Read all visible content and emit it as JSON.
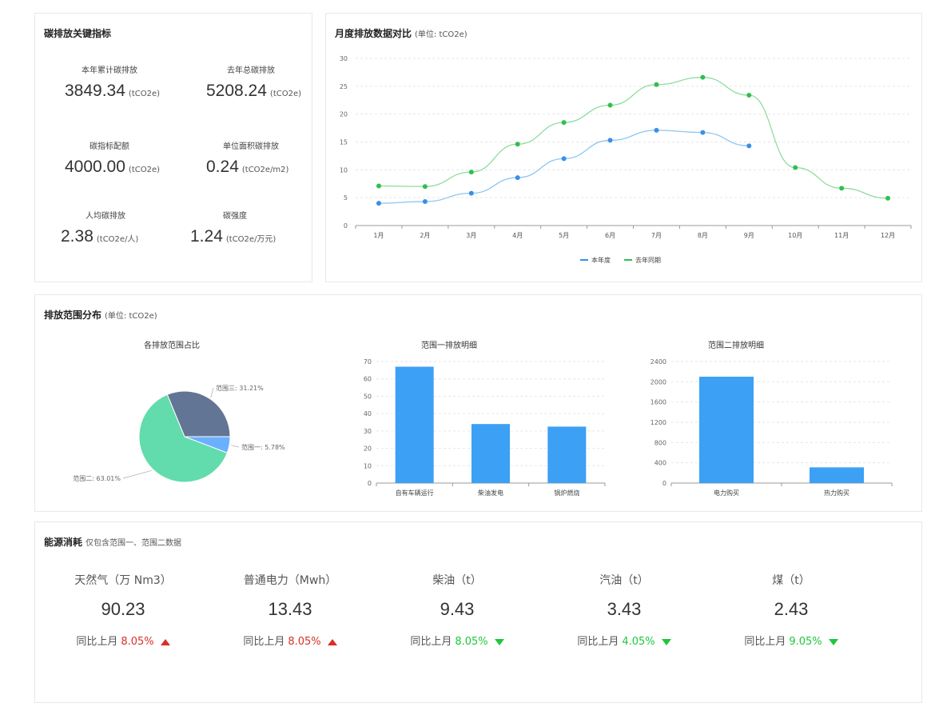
{
  "kpi": {
    "title": "碳排放关键指标",
    "items": [
      {
        "label": "本年累计碳排放",
        "value": "3849.34",
        "unit": "(tCO2e)"
      },
      {
        "label": "去年总碳排放",
        "value": "5208.24",
        "unit": "(tCO2e)"
      },
      {
        "label": "碳指标配额",
        "value": "4000.00",
        "unit": "(tCO2e)"
      },
      {
        "label": "单位面积碳排放",
        "value": "0.24",
        "unit": "(tCO2e/m2)"
      },
      {
        "label": "人均碳排放",
        "value": "2.38",
        "unit": "(tCO2e/人)"
      },
      {
        "label": "碳强度",
        "value": "1.24",
        "unit": "(tCO2e/万元)"
      }
    ]
  },
  "monthly": {
    "title": "月度排放数据对比",
    "unit": "(单位: tCO2e)"
  },
  "scope": {
    "title": "排放范围分布",
    "unit": "(单位: tCO2e)",
    "pie_title": "各排放范围占比",
    "bar1_title": "范围一排放明细",
    "bar2_title": "范围二排放明细"
  },
  "energy": {
    "title": "能源消耗",
    "subtitle": "仅包含范围一、范围二数据",
    "cmp_label": "同比上月",
    "items": [
      {
        "label": "天然气（万 Nm3）",
        "value": "90.23",
        "pct": "8.05%",
        "trend": "up"
      },
      {
        "label": "普通电力（Mwh）",
        "value": "13.43",
        "pct": "8.05%",
        "trend": "up"
      },
      {
        "label": "柴油（t）",
        "value": "9.43",
        "pct": "8.05%",
        "trend": "down"
      },
      {
        "label": "汽油（t）",
        "value": "3.43",
        "pct": "4.05%",
        "trend": "down"
      },
      {
        "label": "煤（t）",
        "value": "2.43",
        "pct": "9.05%",
        "trend": "down"
      }
    ]
  },
  "colors": {
    "up": "#d93026",
    "down": "#1fc73a",
    "this_year": "#3a8fe6",
    "last_year": "#2fbf50",
    "bar": "#3ca0f5",
    "pie": [
      "#6bb0ff",
      "#62dbad",
      "#637594"
    ]
  },
  "chart_data": [
    {
      "type": "line",
      "x": [
        "1月",
        "2月",
        "3月",
        "4月",
        "5月",
        "6月",
        "7月",
        "8月",
        "9月",
        "10月",
        "11月",
        "12月"
      ],
      "series": [
        {
          "name": "本年度",
          "values": [
            4.0,
            4.3,
            5.8,
            8.6,
            12.0,
            15.3,
            17.1,
            16.7,
            14.3,
            null,
            null,
            null
          ]
        },
        {
          "name": "去年同期",
          "values": [
            7.1,
            7.0,
            9.6,
            14.6,
            18.5,
            21.6,
            25.3,
            26.6,
            23.4,
            10.4,
            6.7,
            4.9
          ]
        }
      ],
      "yticks": [
        0,
        5,
        10,
        15,
        20,
        25,
        30
      ],
      "ylim": [
        0,
        30
      ],
      "legend": "bottom"
    },
    {
      "type": "pie",
      "labels": [
        "范围一",
        "范围二",
        "范围三"
      ],
      "values": [
        5.78,
        63.01,
        31.21
      ],
      "label_texts": [
        "范围一: 5.78%",
        "范围二: 63.01%",
        "范围三: 31.21%"
      ]
    },
    {
      "type": "bar",
      "categories": [
        "自有车辆运行",
        "柴油发电",
        "锅炉燃烧"
      ],
      "values": [
        67,
        34,
        32.5
      ],
      "yticks": [
        0,
        10,
        20,
        30,
        40,
        50,
        60,
        70
      ],
      "ylim": [
        0,
        70
      ]
    },
    {
      "type": "bar",
      "categories": [
        "电力购买",
        "热力购买"
      ],
      "values": [
        2100,
        310
      ],
      "yticks": [
        0,
        400,
        800,
        1200,
        1600,
        2000,
        2400
      ],
      "ylim": [
        0,
        2400
      ]
    }
  ]
}
